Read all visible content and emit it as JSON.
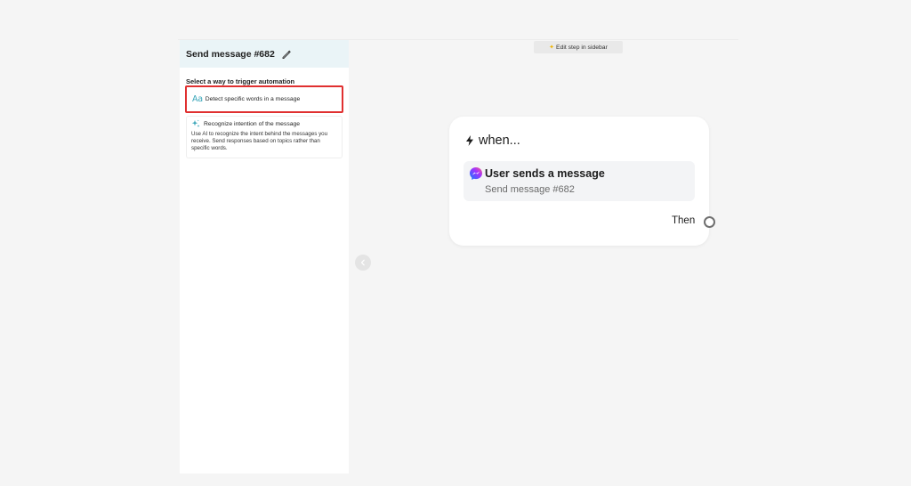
{
  "sidebar": {
    "title": "Send message #682",
    "section_label": "Select a way to trigger automation",
    "options": [
      {
        "icon_text": "Aa",
        "label": "Detect specific words in a message"
      },
      {
        "label": "Recognize intention of the message",
        "description": "Use AI to recognize the intent behind the messages you receive. Send responses based on topics rather than specific words."
      }
    ]
  },
  "toolbar": {
    "edit_step_label": "Edit step in sidebar"
  },
  "card": {
    "heading": "when...",
    "trigger_title": "User sends a message",
    "trigger_subtitle": "Send message #682",
    "then_label": "Then"
  },
  "colors": {
    "highlight_border": "#e03030",
    "sidebar_header_bg": "#eaf4f7",
    "accent_teal": "#3aa6b9"
  }
}
